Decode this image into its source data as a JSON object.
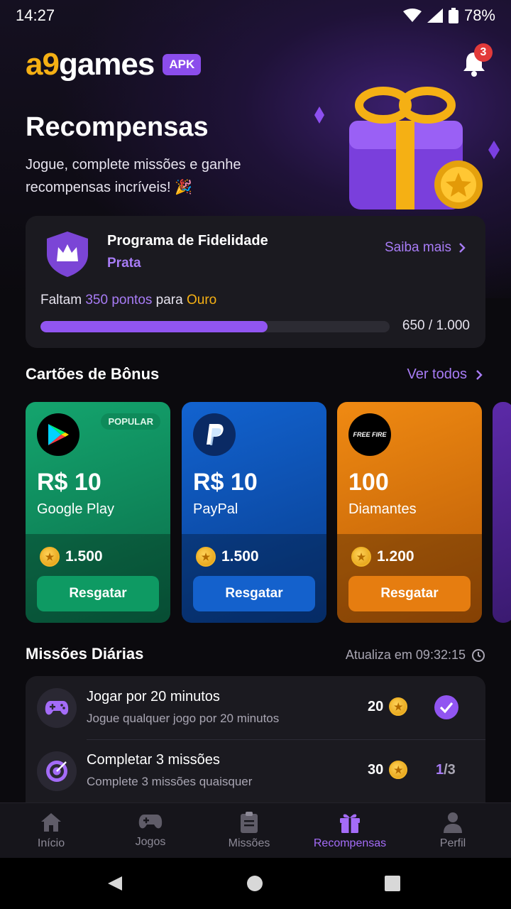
{
  "status_bar": {
    "time": "14:27",
    "battery": "78%"
  },
  "header": {
    "logo_a": "a9",
    "logo_rest": "games",
    "badge": "APK",
    "notifications_count": "3"
  },
  "hero": {
    "title": "Recompensas",
    "subtitle": "Jogue, complete missões e ganhe recompensas incríveis! 🎉"
  },
  "loyalty": {
    "title": "Programa de Fidelidade",
    "tier": "Prata",
    "link": "Saiba mais",
    "remaining_prefix": "Faltam",
    "remaining_points": "350 pontos",
    "remaining_middle": "para",
    "next_tier": "Ouro",
    "progress_label": "650 / 1.000",
    "progress_fraction": 0.65
  },
  "bonus_section": {
    "title": "Cartões de Bônus",
    "link": "Ver todos"
  },
  "cards": [
    {
      "amount": "R$ 10",
      "name": "Google Play",
      "cost": "1.500",
      "button": "Resgatar",
      "badge": "POPULAR"
    },
    {
      "amount": "R$ 10",
      "name": "PayPal",
      "cost": "1.500",
      "button": "Resgatar"
    },
    {
      "amount": "100",
      "name": "Diamantes",
      "cost": "1.200",
      "button": "Resgatar",
      "logo_text": "FREE FIRE"
    }
  ],
  "missions_section": {
    "title": "Missões Diárias",
    "update": "Atualiza em 09:32:15"
  },
  "missions": [
    {
      "title": "Jogar por 20 minutos",
      "desc": "Jogue qualquer jogo por 20 minutos",
      "points": "20",
      "state": "done"
    },
    {
      "title": "Completar 3 missões",
      "desc": "Complete 3 missões quaisquer",
      "points": "30",
      "progress_current": "1",
      "progress_total": "/3"
    }
  ],
  "nav": [
    {
      "label": "Início",
      "icon": "home-icon"
    },
    {
      "label": "Jogos",
      "icon": "gamepad-icon"
    },
    {
      "label": "Missões",
      "icon": "clipboard-icon"
    },
    {
      "label": "Recompensas",
      "icon": "gift-icon",
      "active": true
    },
    {
      "label": "Perfil",
      "icon": "user-icon"
    }
  ],
  "colors": {
    "accent": "#a87cf6",
    "gold": "#f5b014",
    "google_card": "#0e8a5a",
    "paypal_card": "#0b4fb0",
    "freefire_card": "#e07a10"
  }
}
